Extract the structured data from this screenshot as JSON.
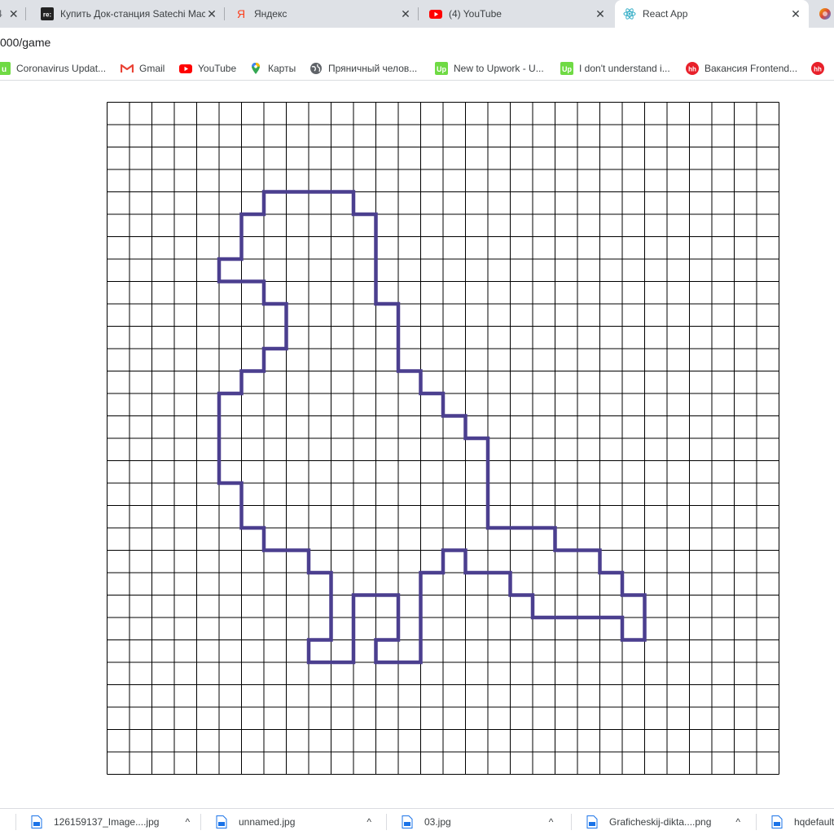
{
  "browser": {
    "tabs": [
      {
        "title": "",
        "favicon": "partial-tab-icon",
        "active": false
      },
      {
        "title": "Купить Док-станция Satechi Mac",
        "favicon": "re-store-icon",
        "active": false
      },
      {
        "title": "Яндекс",
        "favicon": "yandex-icon",
        "active": false
      },
      {
        "title": "(4) YouTube",
        "favicon": "youtube-icon",
        "active": false
      },
      {
        "title": "React App",
        "favicon": "react-icon",
        "active": true
      }
    ],
    "partial_tab_char": "4",
    "close_glyph": "✕",
    "url": "000/game"
  },
  "bookmarks": [
    {
      "label": "Coronavirus Updat...",
      "icon": "upwork-coronavirus-icon"
    },
    {
      "label": "Gmail",
      "icon": "gmail-icon"
    },
    {
      "label": "YouTube",
      "icon": "youtube-icon"
    },
    {
      "label": "Карты",
      "icon": "maps-pin-icon"
    },
    {
      "label": "Пряничный челов...",
      "icon": "globe-icon"
    },
    {
      "label": "New to Upwork - U...",
      "icon": "upwork-icon"
    },
    {
      "label": "I don't understand i...",
      "icon": "upwork-icon"
    },
    {
      "label": "Вакансия Frontend...",
      "icon": "hh-icon"
    },
    {
      "label": "",
      "icon": "hh-icon"
    }
  ],
  "game": {
    "grid_cols": 30,
    "grid_rows": 30,
    "line_color": "#4b3f8f",
    "grid_color": "#000000",
    "path_cells": [
      [
        7,
        4
      ],
      [
        11,
        4
      ],
      [
        11,
        5
      ],
      [
        12,
        5
      ],
      [
        12,
        9
      ],
      [
        13,
        9
      ],
      [
        13,
        12
      ],
      [
        14,
        12
      ],
      [
        14,
        13
      ],
      [
        15,
        13
      ],
      [
        15,
        14
      ],
      [
        16,
        14
      ],
      [
        16,
        15
      ],
      [
        17,
        15
      ],
      [
        17,
        19
      ],
      [
        20,
        19
      ],
      [
        20,
        20
      ],
      [
        22,
        20
      ],
      [
        22,
        21
      ],
      [
        23,
        21
      ],
      [
        23,
        22
      ],
      [
        24,
        22
      ],
      [
        24,
        24
      ],
      [
        23,
        24
      ],
      [
        23,
        23
      ],
      [
        19,
        23
      ],
      [
        19,
        22
      ],
      [
        18,
        22
      ],
      [
        18,
        21
      ],
      [
        16,
        21
      ],
      [
        16,
        20
      ],
      [
        15,
        20
      ],
      [
        15,
        21
      ],
      [
        14,
        21
      ],
      [
        14,
        25
      ],
      [
        12,
        25
      ],
      [
        12,
        24
      ],
      [
        13,
        24
      ],
      [
        13,
        22
      ],
      [
        11,
        22
      ],
      [
        11,
        25
      ],
      [
        9,
        25
      ],
      [
        9,
        24
      ],
      [
        10,
        24
      ],
      [
        10,
        21
      ],
      [
        9,
        21
      ],
      [
        9,
        20
      ],
      [
        7,
        20
      ],
      [
        7,
        19
      ],
      [
        6,
        19
      ],
      [
        6,
        17
      ],
      [
        5,
        17
      ],
      [
        5,
        13
      ],
      [
        6,
        13
      ],
      [
        6,
        12
      ],
      [
        7,
        12
      ],
      [
        7,
        11
      ],
      [
        8,
        11
      ],
      [
        8,
        9
      ],
      [
        7,
        9
      ],
      [
        7,
        8
      ],
      [
        5,
        8
      ],
      [
        5,
        7
      ],
      [
        6,
        7
      ],
      [
        6,
        5
      ],
      [
        7,
        5
      ],
      [
        7,
        4
      ]
    ]
  },
  "downloads": [
    {
      "name": "",
      "icon": "file-icon"
    },
    {
      "name": "126159137_Image....jpg",
      "icon": "file-icon"
    },
    {
      "name": "unnamed.jpg",
      "icon": "file-icon"
    },
    {
      "name": "03.jpg",
      "icon": "file-icon"
    },
    {
      "name": "Graficheskij-dikta....png",
      "icon": "file-icon"
    },
    {
      "name": "hqdefault",
      "icon": "file-icon"
    }
  ],
  "download_chevron": "^"
}
